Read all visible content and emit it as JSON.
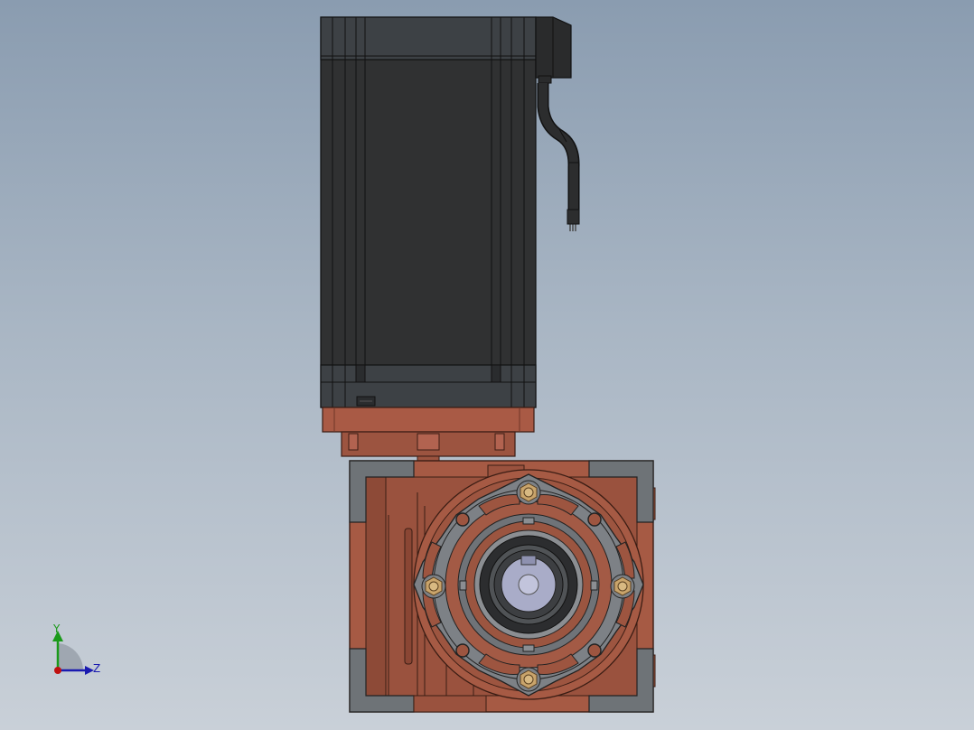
{
  "viewport": {
    "background_top": "#8a9cb0",
    "background_bottom": "#c9d0d8"
  },
  "model": {
    "motor_body_color": "#303132",
    "motor_endcap_color": "#3d4145",
    "adapter_flange_color": "#a95a45",
    "gearbox_color": "#a65a44",
    "gearbox_corner_color": "#6e7377",
    "output_flange_color": "#7d8186",
    "bolt_color": "#c9a46b",
    "shaft_color": "#a9acc8",
    "cable_color": "#1f1f20"
  },
  "triad": {
    "y_axis": {
      "label": "Y",
      "color": "#1a9a1a",
      "icon": "y-axis-arrow-icon"
    },
    "z_axis": {
      "label": "Z",
      "color": "#1a1ab0",
      "icon": "z-axis-arrow-icon"
    },
    "origin_color": "#c01010"
  }
}
